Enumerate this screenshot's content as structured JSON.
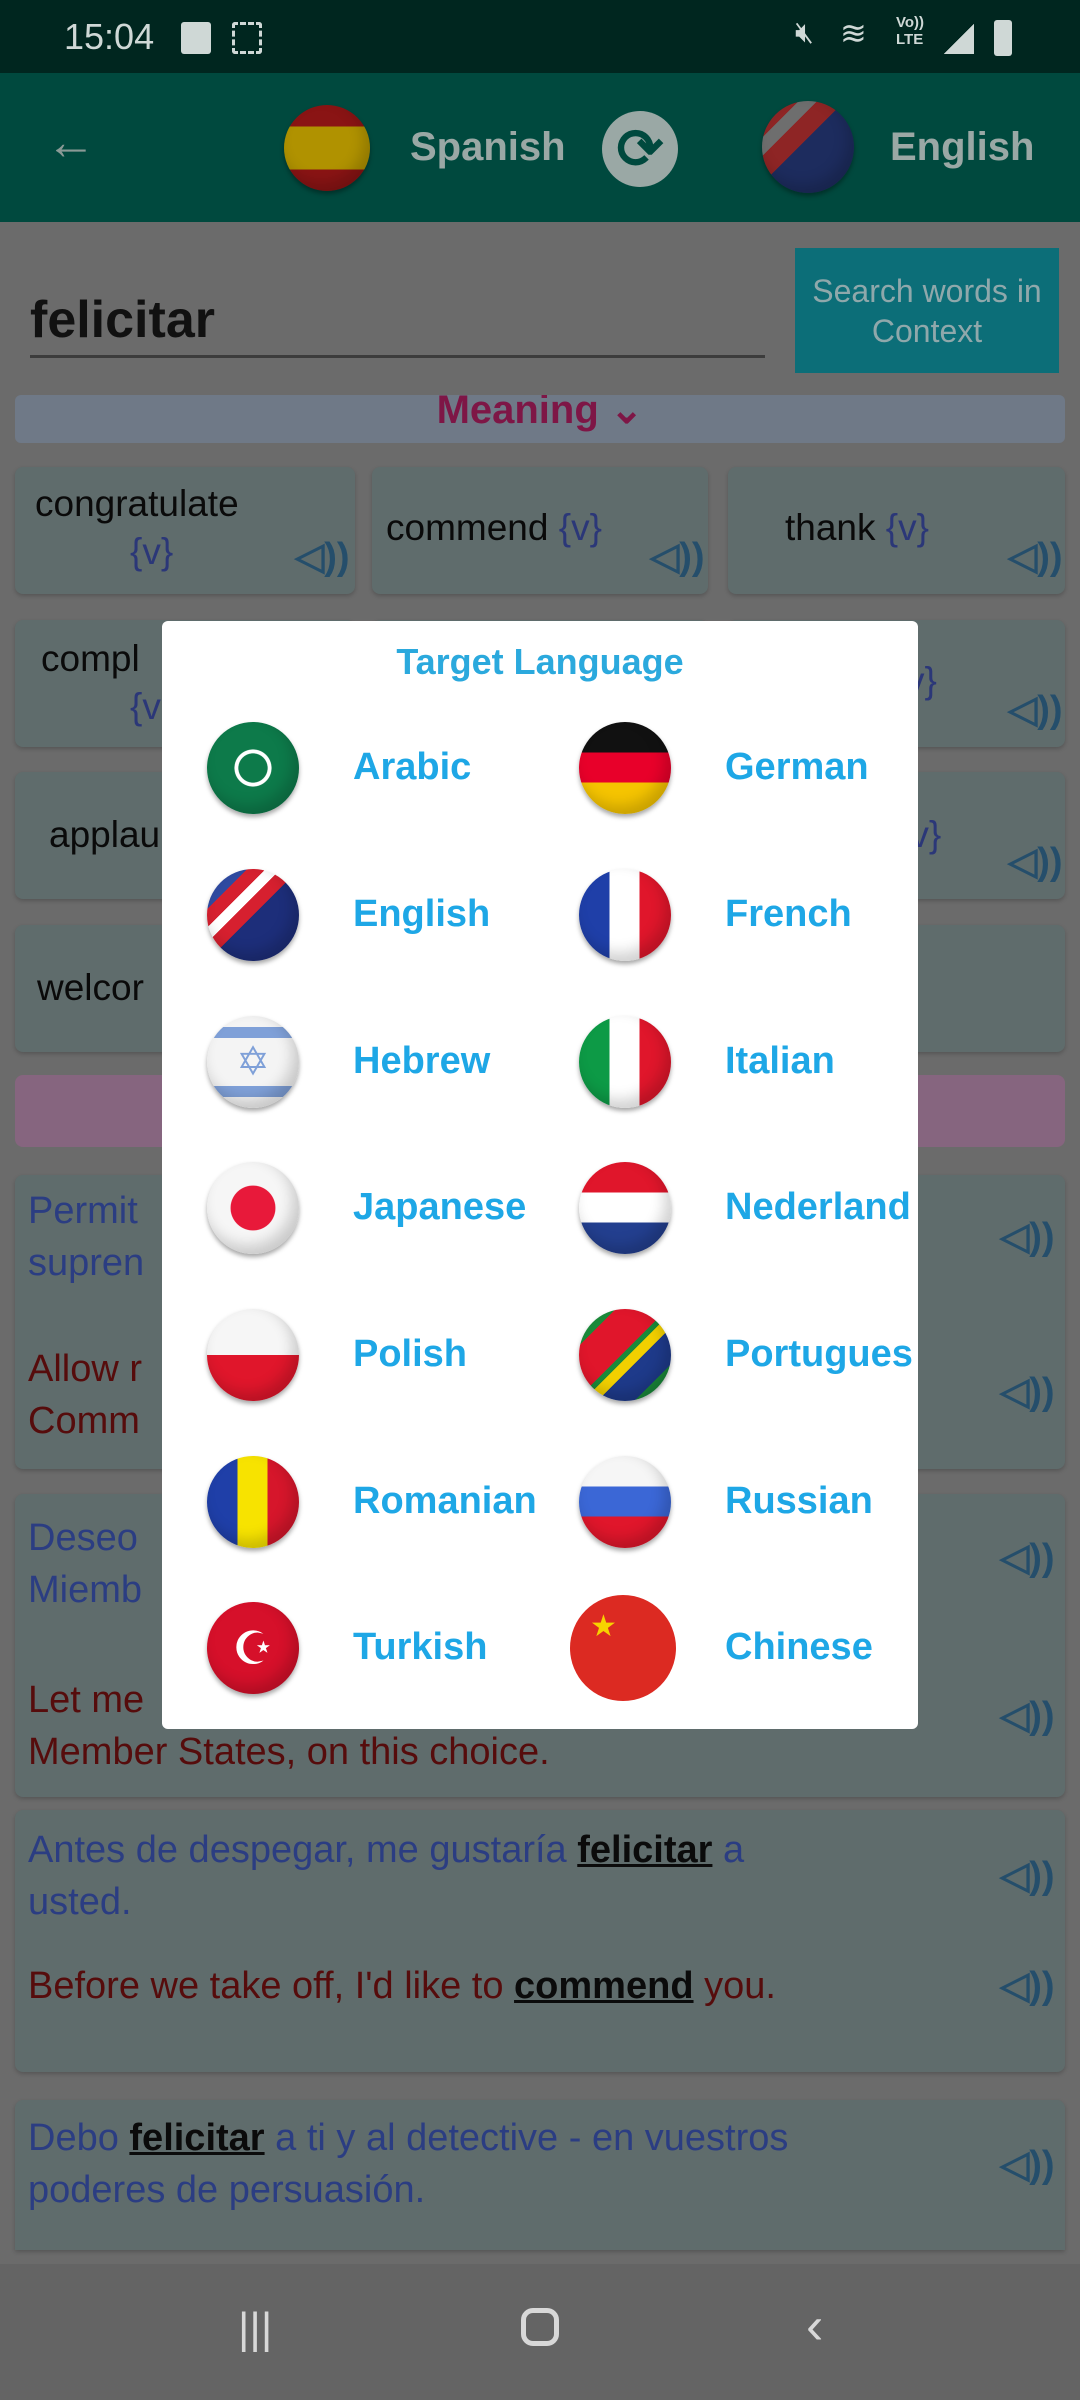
{
  "status_bar": {
    "time": "15:04",
    "icons": [
      "gallery-icon",
      "screen-record-icon",
      "mute-icon",
      "wifi-icon",
      "volte-lte-icon",
      "signal-icon",
      "battery-icon"
    ],
    "volte": "Vo))",
    "lte": "LTE"
  },
  "app_bar": {
    "back_icon": "arrow-left-icon",
    "source_language": "Spanish",
    "swap_icon": "swap-refresh-icon",
    "target_language": "English"
  },
  "search": {
    "value": "felicitar",
    "context_button": "Search words in Context"
  },
  "meaning": {
    "label": "Meaning",
    "icon": "chevron-down-icon"
  },
  "words": [
    {
      "word": "congratulate",
      "pos": "{v}"
    },
    {
      "word": "commend",
      "pos": "{v}"
    },
    {
      "word": "thank",
      "pos": "{v}"
    },
    {
      "word": "compl",
      "pos": "{v"
    },
    {
      "word": "",
      "pos": "v}"
    },
    {
      "word": "applau",
      "pos": ""
    },
    {
      "word": "",
      "pos": "{v}"
    },
    {
      "word": "welcor",
      "pos": ""
    }
  ],
  "sentences": [
    {
      "es": [
        "Permit",
        "supren"
      ],
      "en": [
        "Allow r",
        "Comm"
      ]
    },
    {
      "es": [
        "Deseo",
        "Miemb"
      ],
      "en": [
        "Let me",
        "Member States, on this choice."
      ]
    },
    {
      "es_1": "Antes de despegar, me gustaría ",
      "es_hl": "felicitar",
      "es_2": " a",
      "es_3": "usted.",
      "en_1": "Before we take off, I'd like to ",
      "en_hl": "commend",
      "en_2": " you."
    },
    {
      "es_1": "Debo ",
      "es_hl": "felicitar",
      "es_2": " a ti y al detective - en vuestros",
      "es_3": "poderes de persuasión."
    }
  ],
  "dialog": {
    "title": "Target Language",
    "options": [
      {
        "label": "Arabic",
        "flag": "arab-league-flag-icon"
      },
      {
        "label": "German",
        "flag": "germany-flag-icon"
      },
      {
        "label": "English",
        "flag": "us-uk-flag-icon"
      },
      {
        "label": "French",
        "flag": "france-flag-icon"
      },
      {
        "label": "Hebrew",
        "flag": "israel-flag-icon"
      },
      {
        "label": "Italian",
        "flag": "italy-flag-icon"
      },
      {
        "label": "Japanese",
        "flag": "japan-flag-icon"
      },
      {
        "label": "Nederland",
        "flag": "netherlands-flag-icon"
      },
      {
        "label": "Polish",
        "flag": "poland-flag-icon"
      },
      {
        "label": "Portugues",
        "flag": "portugal-brazil-flag-icon"
      },
      {
        "label": "Romanian",
        "flag": "romania-flag-icon"
      },
      {
        "label": "Russian",
        "flag": "russia-flag-icon"
      },
      {
        "label": "Turkish",
        "flag": "turkey-flag-icon"
      },
      {
        "label": "Chinese",
        "flag": "china-flag-icon"
      }
    ]
  },
  "colors": {
    "app_bar": "#009688",
    "accent": "#1ea7e6",
    "spanish_text": "#3f51b5",
    "english_text": "#8b0000"
  }
}
